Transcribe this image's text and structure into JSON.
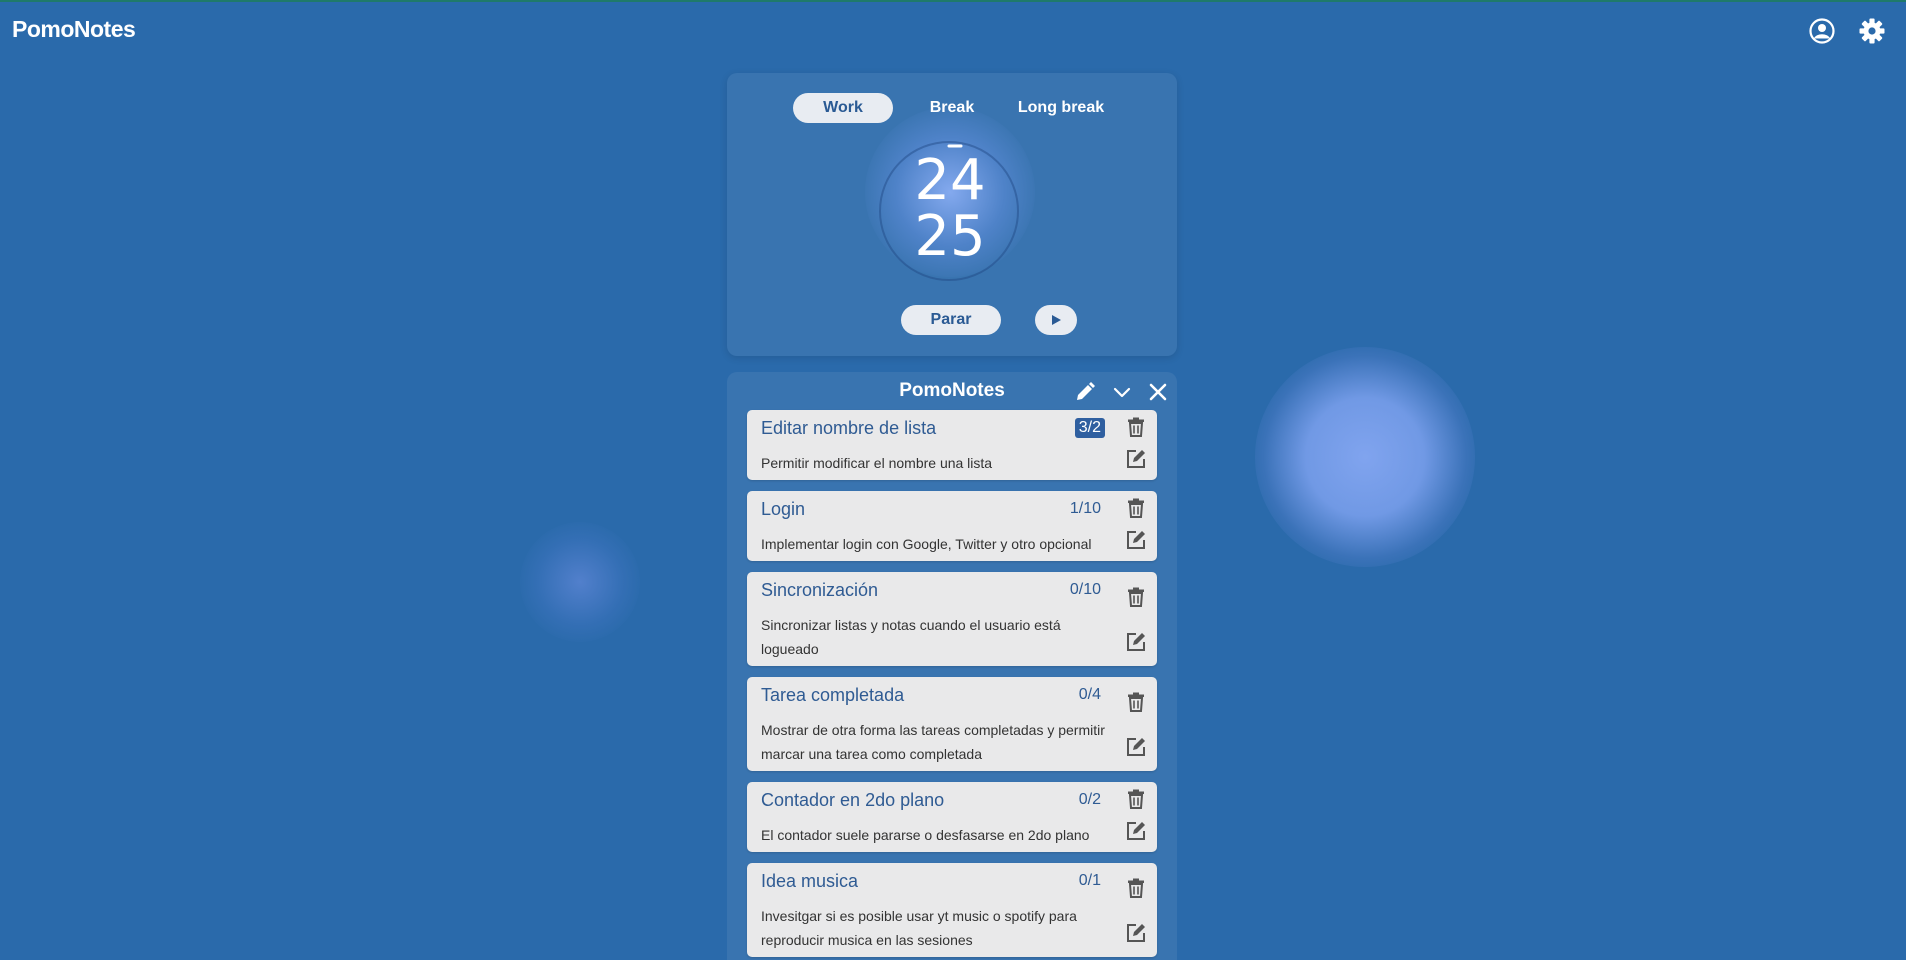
{
  "header": {
    "app_title": "PomoNotes",
    "icons": [
      "user-circle-icon",
      "gear-icon"
    ]
  },
  "timer": {
    "tabs": [
      {
        "label": "Work",
        "active": true
      },
      {
        "label": "Break",
        "active": false
      },
      {
        "label": "Long break",
        "active": false
      }
    ],
    "minutes": "24",
    "seconds": "25",
    "stop_label": "Parar",
    "play_icon": "play-icon"
  },
  "list": {
    "title": "PomoNotes",
    "icons": [
      "pencil-icon",
      "chevron-down-icon",
      "close-icon"
    ],
    "notes": [
      {
        "title": "Editar nombre de lista",
        "count": "3/2",
        "desc": "Permitir modificar el nombre una lista"
      },
      {
        "title": "Login",
        "count": "1/10",
        "desc": "Implementar login con Google, Twitter y otro opcional"
      },
      {
        "title": "Sincronización",
        "count": "0/10",
        "desc": "Sincronizar listas y notas cuando el usuario está logueado"
      },
      {
        "title": "Tarea completada",
        "count": "0/4",
        "desc": "Mostrar de otra forma las tareas completadas y permitir marcar una tarea como completada"
      },
      {
        "title": "Contador en 2do plano",
        "count": "0/2",
        "desc": "El contador suele pararse o desfasarse en 2do plano"
      },
      {
        "title": "Idea musica",
        "count": "0/1",
        "desc": "Invesitgar si es posible usar yt music o spotify para reproducir musica en las sesiones"
      }
    ]
  },
  "colors": {
    "background": "#2a6aab",
    "accent": "#2f5b93",
    "card": "#e9e9ea"
  }
}
